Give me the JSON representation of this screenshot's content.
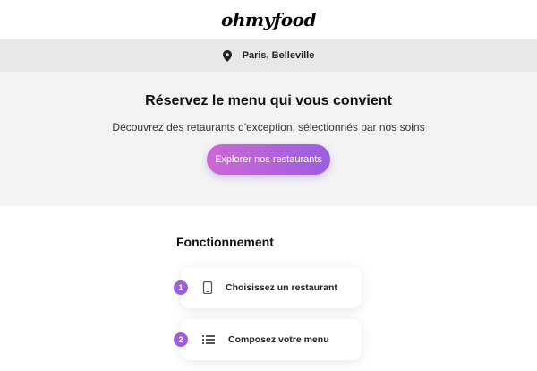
{
  "header": {
    "logo": "ohmyfood"
  },
  "location": {
    "text": "Paris, Belleville",
    "icon": "map-pin-icon"
  },
  "hero": {
    "title": "Réservez le menu qui vous convient",
    "subtitle": "Découvrez des retaurants d'exception, sélectionnés par nos soins",
    "button_label": "Explorer nos restaurants"
  },
  "howto": {
    "title": "Fonctionnement",
    "steps": [
      {
        "number": "1",
        "label": "Choisissez un restaurant",
        "icon": "smartphone-icon"
      },
      {
        "number": "2",
        "label": "Composez votre menu",
        "icon": "list-icon"
      }
    ]
  },
  "colors": {
    "accent": "#9b5ee0",
    "accent_light": "#cc68d4"
  }
}
